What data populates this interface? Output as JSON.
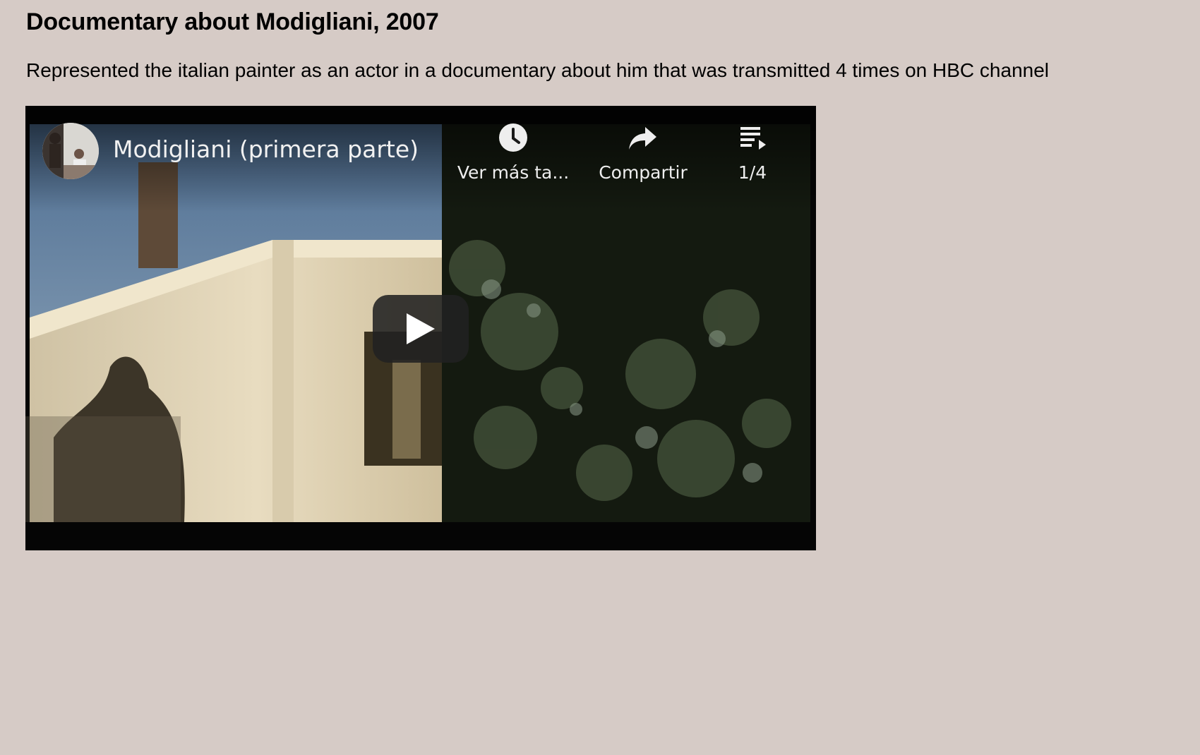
{
  "page": {
    "title": "Documentary about Modigliani, 2007",
    "description": "Represented the italian painter as an actor in a documentary about him that was transmitted 4 times on HBC channel"
  },
  "video": {
    "title": "Modigliani (primera parte)",
    "watch_later_label": "Ver más ta...",
    "share_label": "Compartir",
    "playlist_position": "1/4",
    "icons": {
      "watch_later": "clock-icon",
      "share": "share-arrow-icon",
      "playlist": "playlist-icon",
      "play": "play-icon"
    },
    "colors": {
      "overlay_text": "#eeeeee",
      "play_button_bg": "#212121"
    }
  }
}
